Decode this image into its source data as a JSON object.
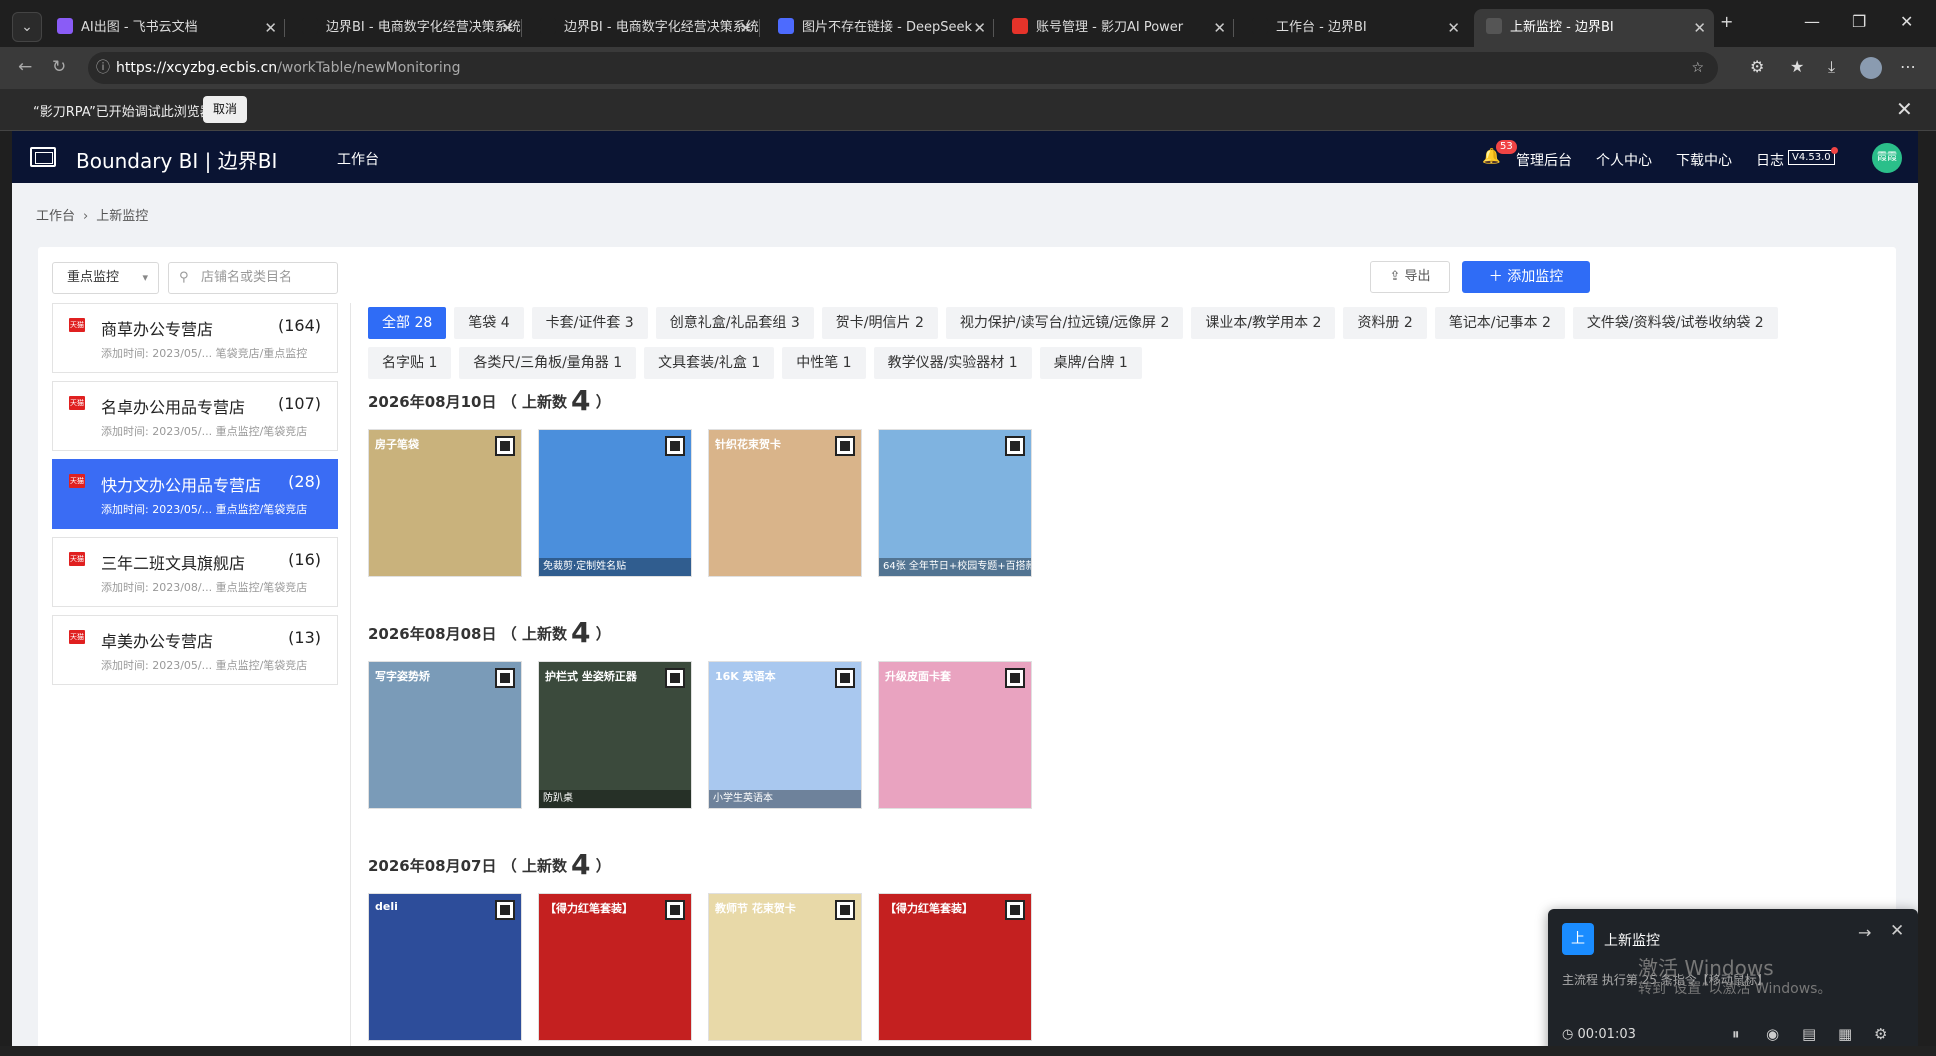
{
  "browser": {
    "tabs": [
      {
        "title": "AI出图 - 飞书云文档",
        "color": "#8a5cf6"
      },
      {
        "title": "边界BI - 电商数字化经营决策系统",
        "color": "#1f1f1f"
      },
      {
        "title": "边界BI - 电商数字化经营决策系统",
        "color": "#1f1f1f"
      },
      {
        "title": "图片不存在链接 - DeepSeek",
        "color": "#4d6bfe"
      },
      {
        "title": "账号管理 - 影刀AI Power",
        "color": "#e5332a"
      },
      {
        "title": "工作台 - 边界BI",
        "color": "#1f1f1f"
      },
      {
        "title": "上新监控 - 边界BI",
        "color": "#555555"
      }
    ],
    "url_host": "https://xcyzbg.ecbis.cn",
    "url_path": "/workTable/newMonitoring",
    "infobar_msg": "“影刀RPA”已开始调试此浏览器",
    "infobar_cancel": "取消"
  },
  "app": {
    "brand": "Boundary BI | 边界BI",
    "nav_work": "工作台",
    "bell_count": "53",
    "admin": "管理后台",
    "personal": "个人中心",
    "download": "下载中心",
    "log": "日志",
    "version": "V4.53.0",
    "user_initials": "霞霞"
  },
  "breadcrumb": {
    "home": "工作台",
    "current": "上新监控"
  },
  "toolbar": {
    "filter_select": "重点监控",
    "search_placeholder": "店铺名或类目名",
    "export": "导出",
    "add": "添加监控"
  },
  "shops": [
    {
      "name": "商草办公专营店",
      "count": "(164)",
      "meta": "添加时间: 2023/05/... 笔袋竞店/重点监控"
    },
    {
      "name": "名卓办公用品专营店",
      "count": "(107)",
      "meta": "添加时间: 2023/05/... 重点监控/笔袋竞店"
    },
    {
      "name": "快力文办公用品专营店",
      "count": "(28)",
      "meta": "添加时间: 2023/05/... 重点监控/笔袋竞店"
    },
    {
      "name": "三年二班文具旗舰店",
      "count": "(16)",
      "meta": "添加时间: 2023/08/... 重点监控/笔袋竞店"
    },
    {
      "name": "卓美办公专营店",
      "count": "(13)",
      "meta": "添加时间: 2023/05/... 重点监控/笔袋竞店"
    }
  ],
  "chips": [
    "全部 28",
    "笔袋 4",
    "卡套/证件套 3",
    "创意礼盒/礼品套组 3",
    "贺卡/明信片 2",
    "视力保护/读写台/拉远镜/远像屏 2",
    "课业本/教学用本 2",
    "资料册 2",
    "笔记本/记事本 2",
    "文件袋/资料袋/试卷收纳袋 2",
    "名字贴 1",
    "各类尺/三角板/量角器 1",
    "文具套装/礼盒 1",
    "中性笔 1",
    "教学仪器/实验器材 1",
    "桌牌/台牌 1"
  ],
  "groups": [
    {
      "date": "2026年08月10日",
      "label": "（ 上新数",
      "count": "4",
      "close": "）",
      "items": [
        {
          "title": "房子笔袋",
          "caption": "",
          "bg": "#c9b27c"
        },
        {
          "title": "",
          "caption": "免裁剪·定制姓名贴",
          "bg": "#4b8fdc"
        },
        {
          "title": "针织花束贺卡",
          "caption": "",
          "bg": "#d9b48a"
        },
        {
          "title": "",
          "caption": "64张 全年节日+校园专题+百搭款",
          "bg": "#7fb3e0"
        }
      ]
    },
    {
      "date": "2026年08月08日",
      "label": "（ 上新数",
      "count": "4",
      "close": "）",
      "items": [
        {
          "title": "写字姿势矫",
          "caption": "",
          "bg": "#7a9bb8"
        },
        {
          "title": "护栏式 坐姿矫正器",
          "caption": "防趴桌",
          "bg": "#3b4a3c"
        },
        {
          "title": "16K 英语本",
          "caption": "小学生英语本",
          "bg": "#a9c8ef"
        },
        {
          "title": "升级皮面卡套",
          "caption": "",
          "bg": "#e9a3c0"
        }
      ]
    },
    {
      "date": "2026年08月07日",
      "label": "（ 上新数",
      "count": "4",
      "close": "）",
      "items": [
        {
          "title": "deli",
          "caption": "",
          "bg": "#2d4d9a"
        },
        {
          "title": "【得力红笔套装】",
          "caption": "",
          "bg": "#c42020"
        },
        {
          "title": "教师节 花束贺卡",
          "caption": "",
          "bg": "#e8d9a8"
        },
        {
          "title": "【得力红笔套装】",
          "caption": "",
          "bg": "#c42020"
        }
      ]
    }
  ],
  "toast": {
    "icon_text": "上",
    "title": "上新监控",
    "status": "主流程 执行第 25 条指令【移动鼠标】",
    "timer": "00:01:03"
  },
  "watermark": {
    "line1": "激活 Windows",
    "line2": "转到“设置”以激活 Windows。"
  }
}
